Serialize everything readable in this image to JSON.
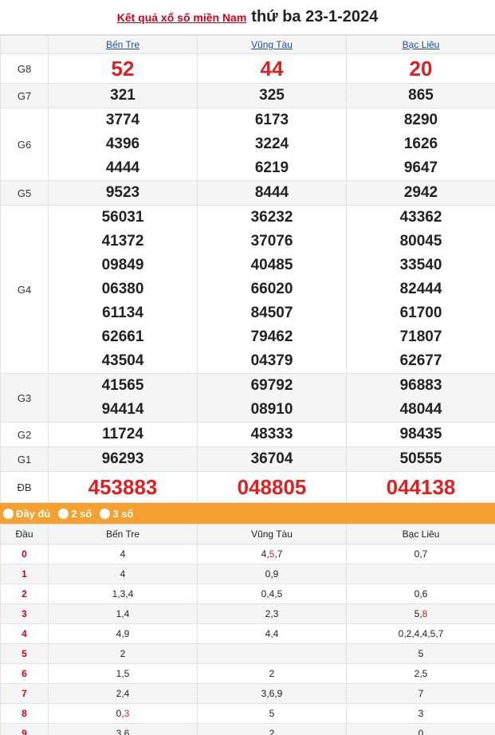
{
  "header": {
    "link": "Kết quả xổ số miền Nam",
    "date": "thứ ba 23-1-2024"
  },
  "provinces": [
    "Bến Tre",
    "Vũng Tàu",
    "Bạc Liêu"
  ],
  "prizes": [
    {
      "label": "G8",
      "values": [
        [
          "52"
        ],
        [
          "44"
        ],
        [
          "20"
        ]
      ]
    },
    {
      "label": "G7",
      "values": [
        [
          "321"
        ],
        [
          "325"
        ],
        [
          "865"
        ]
      ]
    },
    {
      "label": "G6",
      "values": [
        [
          "3774",
          "4396",
          "4444"
        ],
        [
          "6173",
          "3224",
          "6219"
        ],
        [
          "8290",
          "1626",
          "9647"
        ]
      ]
    },
    {
      "label": "G5",
      "values": [
        [
          "9523"
        ],
        [
          "8444"
        ],
        [
          "2942"
        ]
      ]
    },
    {
      "label": "G4",
      "values": [
        [
          "56031",
          "41372",
          "09849",
          "06380",
          "61134",
          "62661",
          "43504"
        ],
        [
          "36232",
          "37076",
          "40485",
          "66020",
          "84507",
          "79462",
          "04379"
        ],
        [
          "43362",
          "80045",
          "33540",
          "82444",
          "61700",
          "71807",
          "62677"
        ]
      ]
    },
    {
      "label": "G3",
      "values": [
        [
          "41565",
          "94414"
        ],
        [
          "69792",
          "08910"
        ],
        [
          "96883",
          "48044"
        ]
      ]
    },
    {
      "label": "G2",
      "values": [
        [
          "11724"
        ],
        [
          "48333"
        ],
        [
          "98435"
        ]
      ]
    },
    {
      "label": "G1",
      "values": [
        [
          "96293"
        ],
        [
          "36704"
        ],
        [
          "50555"
        ]
      ]
    },
    {
      "label": "ĐB",
      "values": [
        [
          "453883"
        ],
        [
          "048805"
        ],
        [
          "044138"
        ]
      ]
    }
  ],
  "filter": {
    "options": [
      "Đầy đủ",
      "2 số",
      "3 số"
    ]
  },
  "dau_table": {
    "head": "Đầu",
    "rows": [
      {
        "k": "0",
        "c": [
          "4",
          "4,5,7",
          "0,7"
        ]
      },
      {
        "k": "1",
        "c": [
          "4",
          "0,9",
          ""
        ]
      },
      {
        "k": "2",
        "c": [
          "1,3,4",
          "0,4,5",
          "0,6"
        ]
      },
      {
        "k": "3",
        "c": [
          "1,4",
          "2,3",
          "5,8"
        ]
      },
      {
        "k": "4",
        "c": [
          "4,9",
          "4,4",
          "0,2,4,4,5,7"
        ]
      },
      {
        "k": "5",
        "c": [
          "2",
          "",
          "5"
        ]
      },
      {
        "k": "6",
        "c": [
          "1,5",
          "2",
          "2,5"
        ]
      },
      {
        "k": "7",
        "c": [
          "2,4",
          "3,6,9",
          "7"
        ]
      },
      {
        "k": "8",
        "c": [
          "0,3",
          "5",
          "3"
        ]
      },
      {
        "k": "9",
        "c": [
          "3,6",
          "2",
          "0"
        ]
      }
    ]
  },
  "colors": {
    "accent": "#f6a030",
    "red": "#e02020",
    "link": "#1a4f9c"
  }
}
